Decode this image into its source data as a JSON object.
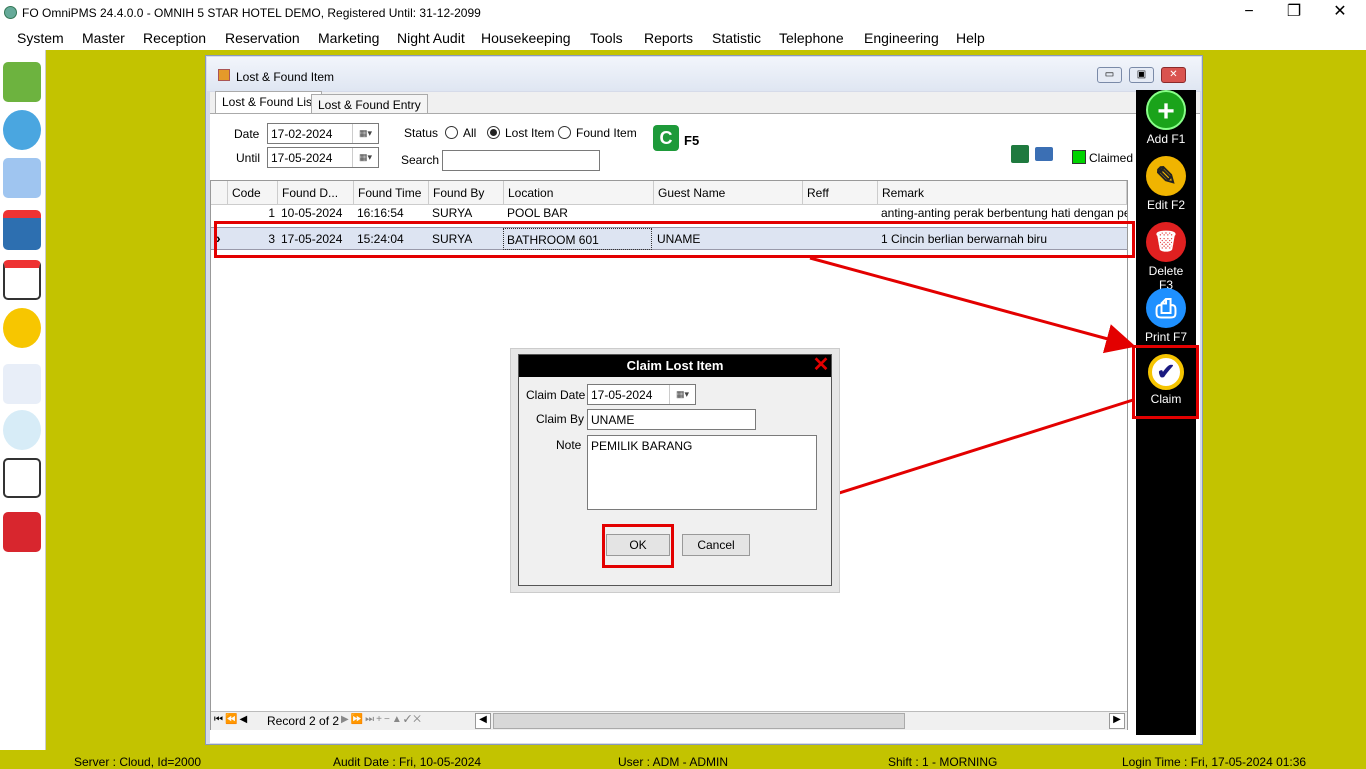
{
  "app": {
    "title": "FO OmniPMS 24.4.0.0 - OMNIH 5 STAR HOTEL DEMO, Registered Until: 31-12-2099",
    "minimize": "−",
    "restore": "❐",
    "close": "✕"
  },
  "menu": [
    "System",
    "Master",
    "Reception",
    "Reservation",
    "Marketing",
    "Night Audit",
    "Housekeeping",
    "Tools",
    "Reports",
    "Statistic",
    "Telephone",
    "Engineering",
    "Help"
  ],
  "window": {
    "title": "Lost & Found Item"
  },
  "tabs": [
    "Lost & Found List",
    "Lost & Found Entry"
  ],
  "filters": {
    "date_label": "Date",
    "date_value": "17-02-2024",
    "until_label": "Until",
    "until_value": "17-05-2024",
    "status_label": "Status",
    "status_options": [
      "All",
      "Lost Item",
      "Found Item"
    ],
    "status_selected": "Lost Item",
    "search_label": "Search",
    "search_value": "",
    "refresh_label": "F5",
    "claimed_legend": "Claimed",
    "claimed_color": "#00d400"
  },
  "grid": {
    "columns": [
      "Code",
      "Found D...",
      "Found Time",
      "Found By",
      "Location",
      "Guest Name",
      "Reff",
      "Remark"
    ],
    "rows": [
      {
        "code": "1",
        "found_date": "10-05-2024",
        "found_time": "16:16:54",
        "found_by": "SURYA",
        "location": "POOL BAR",
        "guest": "",
        "reff": "",
        "remark": "anting-anting perak berbentung hati dengan perma"
      },
      {
        "code": "3",
        "found_date": "17-05-2024",
        "found_time": "15:24:04",
        "found_by": "SURYA",
        "location": "BATHROOM 601",
        "guest": "UNAME",
        "reff": "",
        "remark": "1 Cincin berlian berwarnah biru",
        "indicator": "›"
      }
    ],
    "record_text": "Record 2 of 2"
  },
  "actions": [
    {
      "label": "Add F1",
      "icon": "+",
      "color": "#1aa31a"
    },
    {
      "label": "Edit F2",
      "icon": "✎",
      "color": "#f0b400"
    },
    {
      "label": "Delete F3",
      "icon": "🗑",
      "color": "#e02020"
    },
    {
      "label": "Print F7",
      "icon": "⎙",
      "color": "#1e90ff"
    },
    {
      "label": "Claim",
      "icon": "✔",
      "color": "#f5c400"
    }
  ],
  "dialog": {
    "title": "Claim Lost Item",
    "claim_date_label": "Claim Date",
    "claim_date_value": "17-05-2024",
    "claim_by_label": "Claim By",
    "claim_by_value": "UNAME",
    "note_label": "Note",
    "note_value": "PEMILIK BARANG",
    "ok_label": "OK",
    "cancel_label": "Cancel"
  },
  "status": {
    "server": "Server : Cloud, Id=2000",
    "audit_date": "Audit Date : Fri, 10-05-2024",
    "user": "User : ADM - ADMIN",
    "shift": "Shift : 1 - MORNING",
    "login_time": "Login Time : Fri, 17-05-2024 01:36"
  }
}
